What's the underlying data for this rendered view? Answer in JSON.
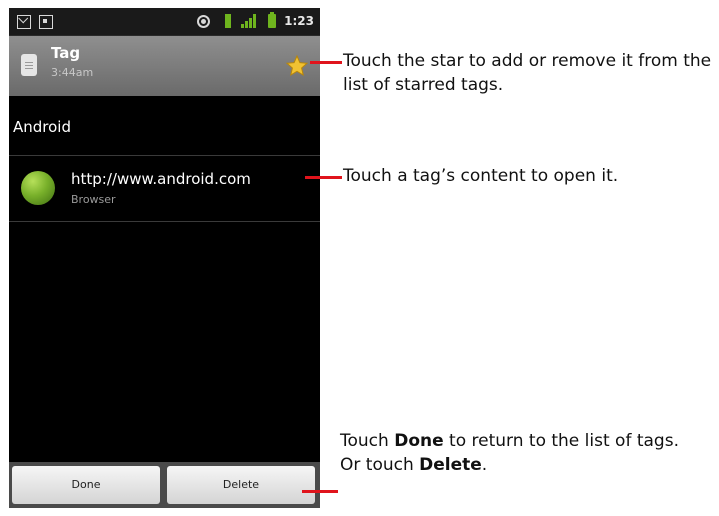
{
  "status_bar": {
    "time": "1:23",
    "icons": [
      "mail-icon",
      "calendar-icon",
      "location-icon",
      "usb-icon",
      "signal-icon",
      "battery-icon"
    ]
  },
  "header": {
    "title": "Tag",
    "subtitle": "3:44am",
    "star_icon": "star-icon"
  },
  "section": {
    "label": "Android"
  },
  "item": {
    "url": "http://www.android.com",
    "subtitle": "Browser",
    "icon": "globe-icon"
  },
  "buttons": {
    "done": "Done",
    "delete": "Delete"
  },
  "callouts": {
    "star": "Touch the star to add or remove it from the list of starred tags.",
    "content": "Touch a tag’s content to open it.",
    "done_prefix": "Touch ",
    "done_bold": "Done",
    "done_suffix": " to return to the list of tags.",
    "or_prefix": "Or touch ",
    "delete_bold": "Delete",
    "or_suffix": "."
  },
  "colors": {
    "callout_line": "#e0141c",
    "star": "#f1c232",
    "globe": "#78b02a"
  }
}
